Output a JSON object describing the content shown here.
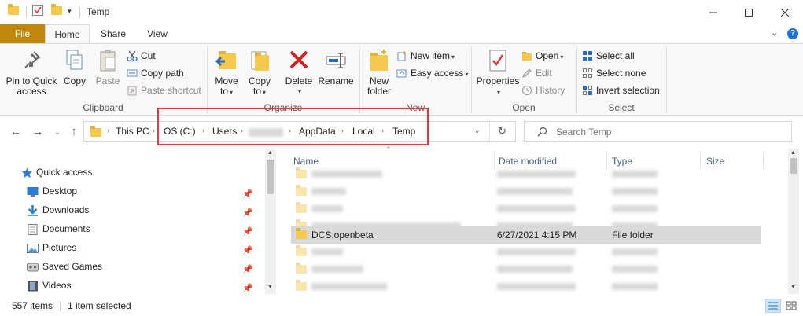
{
  "window": {
    "title": "Temp"
  },
  "tabs": {
    "file": "File",
    "home": "Home",
    "share": "Share",
    "view": "View"
  },
  "ribbon": {
    "clipboard": {
      "label": "Clipboard",
      "pin_line1": "Pin to Quick",
      "pin_line2": "access",
      "copy": "Copy",
      "paste": "Paste",
      "cut": "Cut",
      "copy_path": "Copy path",
      "paste_shortcut": "Paste shortcut"
    },
    "organize": {
      "label": "Organize",
      "move_line1": "Move",
      "move_line2": "to",
      "copy_line1": "Copy",
      "copy_line2": "to",
      "delete": "Delete",
      "rename": "Rename"
    },
    "new": {
      "label": "New",
      "new_folder_line1": "New",
      "new_folder_line2": "folder",
      "new_item": "New item",
      "easy_access": "Easy access"
    },
    "open": {
      "label": "Open",
      "properties": "Properties",
      "open": "Open",
      "edit": "Edit",
      "history": "History"
    },
    "select": {
      "label": "Select",
      "select_all": "Select all",
      "select_none": "Select none",
      "invert": "Invert selection"
    }
  },
  "address": {
    "crumbs": [
      "This PC",
      "OS (C:)",
      "Users",
      "AppData",
      "Local",
      "Temp"
    ],
    "search_placeholder": "Search Temp"
  },
  "nav": {
    "quick_access": "Quick access",
    "items": [
      "Desktop",
      "Downloads",
      "Documents",
      "Pictures",
      "Saved Games",
      "Videos"
    ]
  },
  "columns": {
    "name": "Name",
    "date": "Date modified",
    "type": "Type",
    "size": "Size"
  },
  "selected_row": {
    "name": "DCS.openbeta",
    "date": "6/27/2021 4:15 PM",
    "type": "File folder"
  },
  "status": {
    "items": "557 items",
    "selected": "1 item selected"
  },
  "colors": {
    "file_tab": "#c0870a",
    "highlight": "#e0393e",
    "folder": "#f5c94c",
    "selection": "#d9d9d9"
  }
}
